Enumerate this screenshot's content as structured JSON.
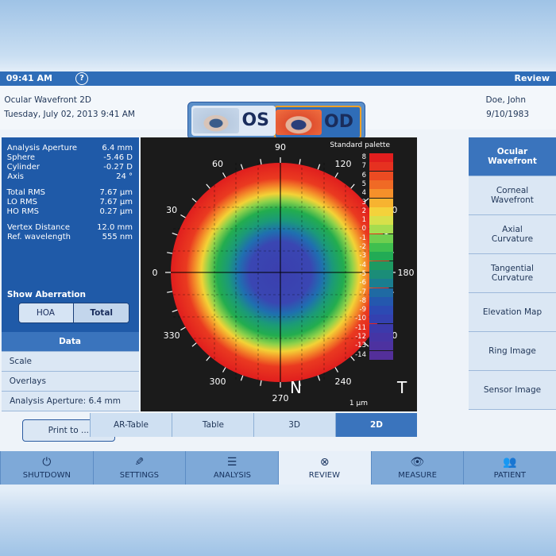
{
  "status_bar": {
    "left_label": "Review",
    "time": "09:41 AM"
  },
  "patient": {
    "name": "Doe, John",
    "dob": "9/10/1983"
  },
  "exam": {
    "title": "Ocular Wavefront 2D",
    "datetime": "Tuesday, July 02, 2013 9:41 AM"
  },
  "eye_selector": {
    "od": "OD",
    "os": "OS"
  },
  "side_menu": {
    "items": [
      "Ocular Wavefront",
      "Corneal Wavefront",
      "Axial Curvature",
      "Tangential Curvature",
      "Elevation Map",
      "Ring Image",
      "Sensor Image"
    ]
  },
  "info": {
    "rows": [
      {
        "k": "Analysis Aperture",
        "v": "6.4 mm"
      },
      {
        "k": "Sphere",
        "v": "-5.46 D"
      },
      {
        "k": "Cylinder",
        "v": "-0.27 D"
      },
      {
        "k": "Axis",
        "v": "24 °"
      },
      {
        "k": "Total RMS",
        "v": "7.67 µm"
      },
      {
        "k": "LO RMS",
        "v": "7.67 µm"
      },
      {
        "k": "HO RMS",
        "v": "0.27 µm"
      },
      {
        "k": "Vertex Distance",
        "v": "12.0 mm"
      },
      {
        "k": "Ref. wavelength",
        "v": "555 nm"
      }
    ],
    "show_aberration": "Show Aberration",
    "toggle_total": "Total",
    "toggle_hoa": "HOA"
  },
  "data_list": {
    "header": "Data",
    "scale": "Scale",
    "overlays": "Overlays",
    "aperture": "Analysis Aperture: 6.4 mm"
  },
  "print": "Print to ...",
  "map": {
    "palette_title": "Standard palette",
    "unit": "1 µm",
    "nasal": "N",
    "temporal": "T",
    "angles": [
      "0",
      "30",
      "60",
      "90",
      "120",
      "150",
      "180",
      "210",
      "240",
      "270",
      "300",
      "330"
    ],
    "scale_labels": [
      "8",
      "7",
      "6",
      "5",
      "4",
      "3",
      "2",
      "1",
      "0",
      "-1",
      "-2",
      "-3",
      "-4",
      "-5",
      "-6",
      "-7",
      "-8",
      "-9",
      "-10",
      "-11",
      "-12",
      "-13",
      "-14"
    ],
    "scale_colors": [
      "#e01e1e",
      "#e63120",
      "#ec4b22",
      "#f06a25",
      "#f5902a",
      "#f7b330",
      "#f4d23b",
      "#d7e04a",
      "#a6dc4f",
      "#6fcf4f",
      "#3fbf4f",
      "#22ab55",
      "#1e9a62",
      "#1b8d78",
      "#1a7e90",
      "#1f6aa3",
      "#2458ae",
      "#2c4ab3",
      "#3441b0",
      "#3c3aab",
      "#4535a5",
      "#4d32a0",
      "#532f9a"
    ]
  },
  "view_tabs": [
    "2D",
    "3D",
    "Table",
    "AR-Table"
  ],
  "bottom_nav": [
    "PATIENT",
    "MEASURE",
    "REVIEW",
    "ANALYSIS",
    "SETTINGS",
    "SHUTDOWN"
  ],
  "colors": {
    "accent": "#2f6db8",
    "panel": "#1f5aa8",
    "tab_active": "#3a74bd"
  }
}
